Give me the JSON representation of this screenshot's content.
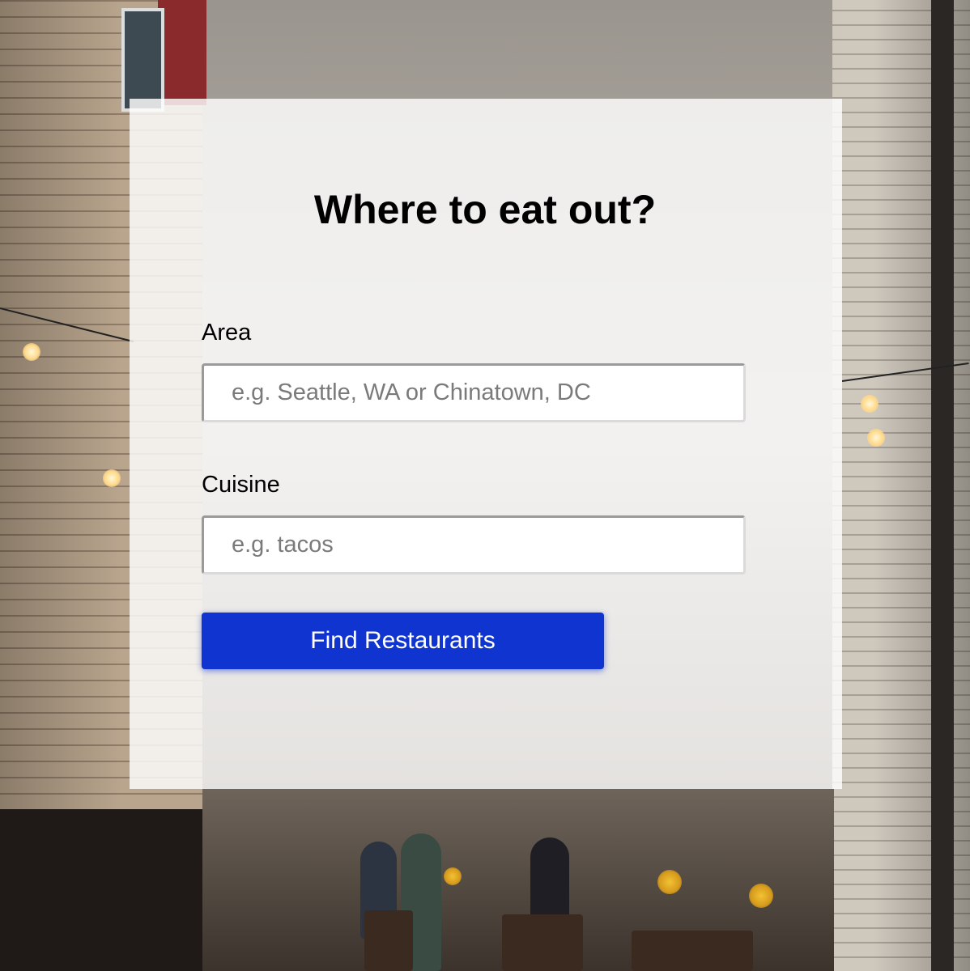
{
  "page": {
    "title": "Where to eat out?"
  },
  "form": {
    "area": {
      "label": "Area",
      "placeholder": "e.g. Seattle, WA or Chinatown, DC",
      "value": ""
    },
    "cuisine": {
      "label": "Cuisine",
      "placeholder": "e.g. tacos",
      "value": ""
    },
    "submit_label": "Find Restaurants"
  },
  "colors": {
    "button_background": "#1034d0",
    "button_text": "#ffffff",
    "card_background": "rgba(255,255,255,0.82)"
  }
}
